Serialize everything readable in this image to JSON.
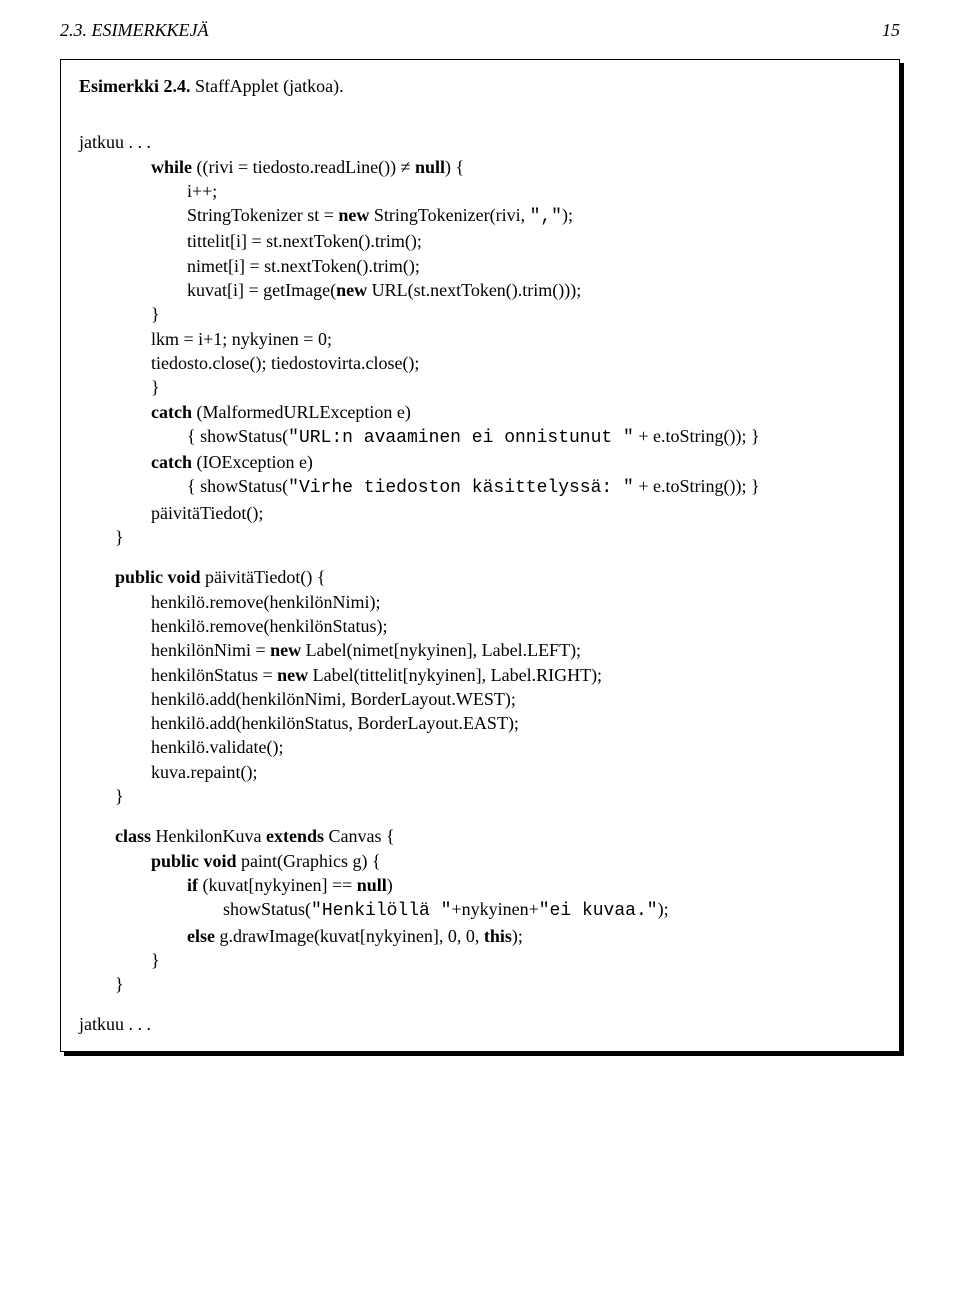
{
  "header": {
    "section": "2.3. ESIMERKKEJÄ",
    "page_num": "15"
  },
  "box": {
    "title_bold": "Esimerkki 2.4.",
    "title_rest": " StaffApplet (jatkoa).",
    "cont_top": "jatkuu . . .",
    "c1": {
      "l1a": "while",
      "l1b": " ((rivi = tiedosto.readLine()) ",
      "l1c": "≠",
      "l1d": " ",
      "l1e": "null",
      "l1f": ") {",
      "l2": "i++;",
      "l3a": "StringTokenizer st = ",
      "l3b": "new",
      "l3c": " StringTokenizer(rivi, ",
      "l3d": "\",\"",
      "l3e": ");",
      "l4": "tittelit[i] = st.nextToken().trim();",
      "l5": "nimet[i] = st.nextToken().trim();",
      "l6a": "kuvat[i] = getImage(",
      "l6b": "new",
      "l6c": " URL(st.nextToken().trim()));",
      "l7": "}",
      "l8": "lkm = i+1; nykyinen = 0;",
      "l9": "tiedosto.close(); tiedostovirta.close();",
      "l10": "}",
      "l11a": "catch",
      "l11b": " (MalformedURLException e)",
      "l12a": "{ showStatus(",
      "l12b": "\"URL:n avaaminen ei onnistunut \"",
      "l12c": " + e.toString()); }",
      "l13a": "catch",
      "l13b": " (IOException e)",
      "l14a": "{ showStatus(",
      "l14b": "\"Virhe tiedoston käsittelyssä: \"",
      "l14c": " + e.toString()); }",
      "l15": "päivitäTiedot();",
      "l16": "}"
    },
    "c2": {
      "l1a": "public void",
      "l1b": " päivitäTiedot() {",
      "l2": "henkilö.remove(henkilönNimi);",
      "l3": "henkilö.remove(henkilönStatus);",
      "l4a": "henkilönNimi = ",
      "l4b": "new",
      "l4c": " Label(nimet[nykyinen], Label.LEFT);",
      "l5a": "henkilönStatus = ",
      "l5b": "new",
      "l5c": " Label(tittelit[nykyinen], Label.RIGHT);",
      "l6": "henkilö.add(henkilönNimi, BorderLayout.WEST);",
      "l7": "henkilö.add(henkilönStatus, BorderLayout.EAST);",
      "l8": "henkilö.validate();",
      "l9": "kuva.repaint();",
      "l10": "}"
    },
    "c3": {
      "l1a": "class",
      "l1b": " HenkilonKuva ",
      "l1c": "extends",
      "l1d": " Canvas {",
      "l2a": "public void",
      "l2b": " paint(Graphics g) {",
      "l3a": "if",
      "l3b": " (kuvat[nykyinen] == ",
      "l3c": "null",
      "l3d": ")",
      "l4a": "showStatus(",
      "l4b": "\"Henkilöllä \"",
      "l4c": "+nykyinen+",
      "l4d": "\"ei kuvaa.\"",
      "l4e": ");",
      "l5a": "else",
      "l5b": " g.drawImage(kuvat[nykyinen], 0, 0, ",
      "l5c": "this",
      "l5d": ");",
      "l6": "}",
      "l7": "}"
    },
    "cont_bottom": "jatkuu . . ."
  }
}
